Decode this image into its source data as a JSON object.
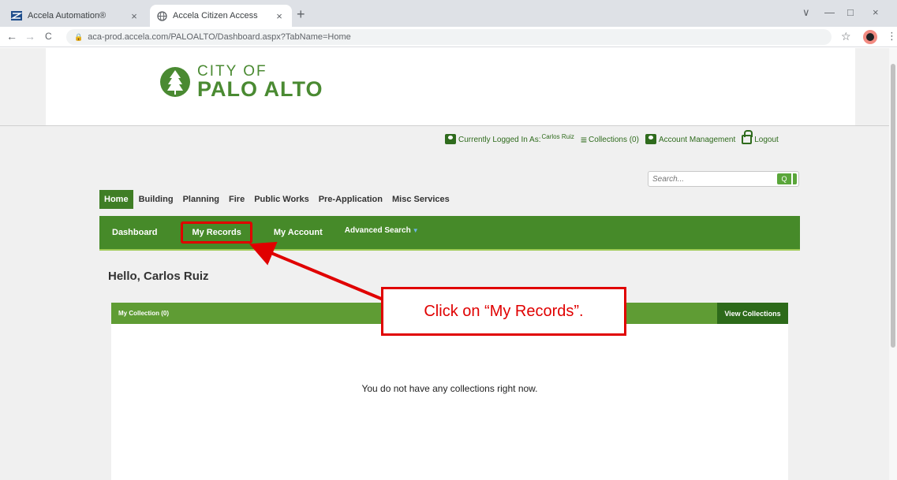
{
  "browser": {
    "tabs": [
      {
        "title": "Accela Automation®",
        "close": "×"
      },
      {
        "title": "Accela Citizen Access",
        "close": "×"
      }
    ],
    "new_tab": "+",
    "url": "aca-prod.accela.com/PALOALTO/Dashboard.aspx?TabName=Home",
    "controls": {
      "back": "←",
      "forward": "→",
      "reload": "C",
      "star": "☆",
      "menu": "⋮",
      "minimize": "—",
      "restore": "□",
      "close": "×",
      "tabs_dropdown": "∨"
    }
  },
  "logo": {
    "line1": "CITY OF",
    "line2": "PALO ALTO",
    "color": "#4a8a32"
  },
  "userbar": {
    "logged_in_label": "Currently Logged In As:",
    "user_name": "Carlos Ruiz",
    "collections_label": "Collections (0)",
    "account_label": "Account Management",
    "logout_label": "Logout"
  },
  "search": {
    "placeholder": "Search...",
    "button": "Q"
  },
  "main_tabs": [
    "Home",
    "Building",
    "Planning",
    "Fire",
    "Public Works",
    "Pre-Application",
    "Misc Services"
  ],
  "sub_nav": {
    "dashboard": "Dashboard",
    "my_records": "My Records",
    "my_account": "My Account",
    "advanced_search": "Advanced Search",
    "caret": "▼"
  },
  "greeting": "Hello, Carlos Ruiz",
  "collection_panel": {
    "title": "My Collection (0)",
    "view_button": "View Collections",
    "empty_message": "You do not have any collections right now."
  },
  "callout": {
    "text": "Click on “My Records”.",
    "color": "#e00000"
  },
  "colors": {
    "nav_green": "#468a29",
    "panel_green": "#5f9c34",
    "dark_green": "#2d6a1a",
    "highlight_red": "#e00000"
  }
}
